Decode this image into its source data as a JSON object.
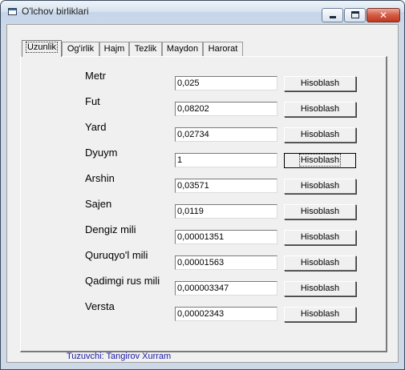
{
  "window": {
    "title": "O'lchov birliklari"
  },
  "tabs": [
    "Uzunlik",
    "Og'irlik",
    "Hajm",
    "Tezlik",
    "Maydon",
    "Harorat"
  ],
  "rows": [
    {
      "label": "Metr",
      "value": "0,025",
      "button": "Hisoblash"
    },
    {
      "label": "Fut",
      "value": "0,08202",
      "button": "Hisoblash"
    },
    {
      "label": "Yard",
      "value": "0,02734",
      "button": "Hisoblash"
    },
    {
      "label": "Dyuym",
      "value": "1",
      "button": "Hisoblash"
    },
    {
      "label": "Arshin",
      "value": "0,03571",
      "button": "Hisoblash"
    },
    {
      "label": "Sajen",
      "value": "0,0119",
      "button": "Hisoblash"
    },
    {
      "label": "Dengiz mili",
      "value": "0,00001351",
      "button": "Hisoblash"
    },
    {
      "label": "Quruqyo'l mili",
      "value": "0,00001563",
      "button": "Hisoblash"
    },
    {
      "label": "Qadimgi rus mili",
      "value": "0,000003347",
      "button": "Hisoblash"
    },
    {
      "label": "Versta",
      "value": "0,00002343",
      "button": "Hisoblash"
    }
  ],
  "footer": {
    "author": "Tuzuvchi: Tangirov Xurram"
  },
  "colors": {
    "author_text": "#1a1aa6",
    "close_button": "#c1381f"
  }
}
